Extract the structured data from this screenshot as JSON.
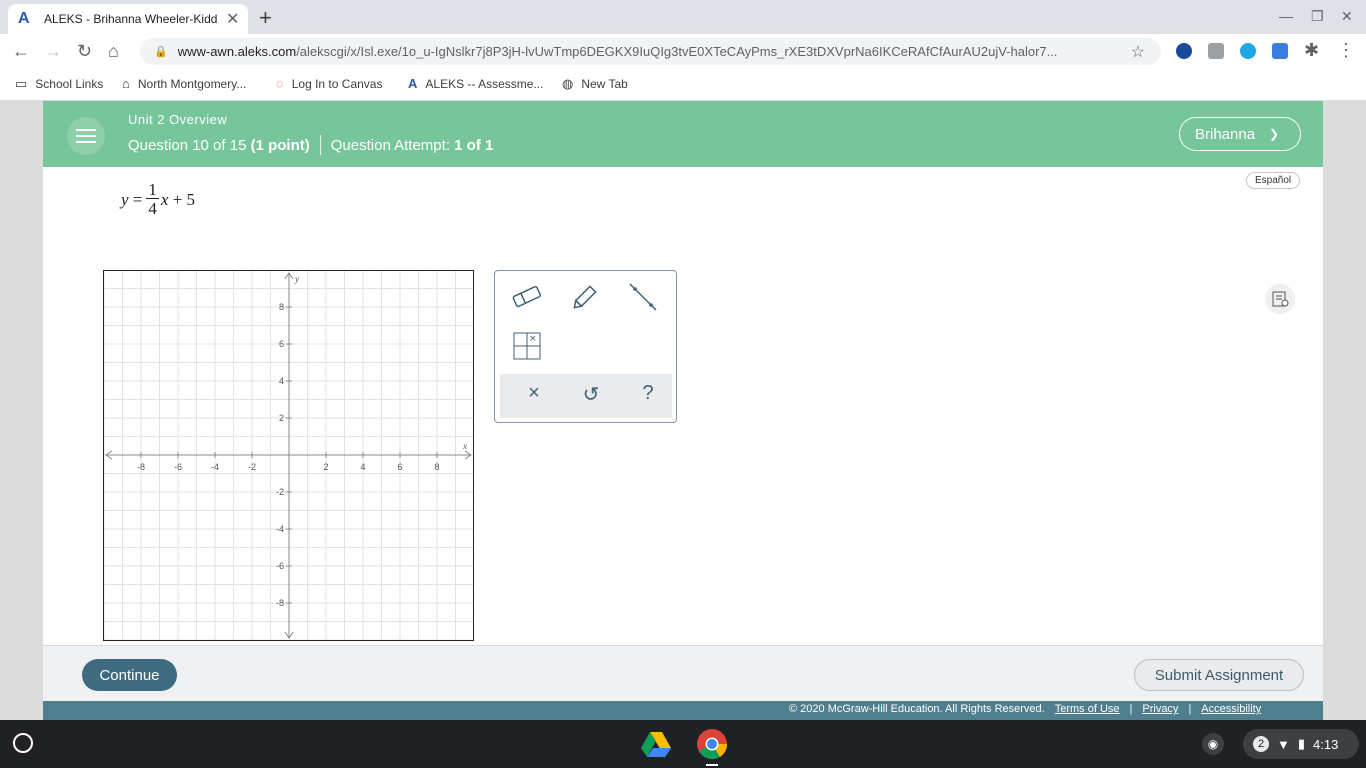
{
  "browser": {
    "tab_title": "ALEKS - Brihanna Wheeler-Kidd -",
    "url_host": "www-awn.aleks.com",
    "url_path": "/alekscgi/x/Isl.exe/1o_u-IgNslkr7j8P3jH-lvUwTmp6DEGKX9IuQIg3tvE0XTeCAyPms_rXE3tDXVprNa6IKCeRAfCfAurAU2ujV-halor7...",
    "bookmarks": [
      "School Links",
      "North Montgomery...",
      "Log In to Canvas",
      "ALEKS -- Assessme...",
      "New Tab"
    ]
  },
  "header": {
    "unit": "Unit 2 Overview",
    "question": "Question 10 of 15",
    "points": "(1 point)",
    "attempt_label": "Question Attempt:",
    "attempt_value": "1 of 1",
    "user": "Brihanna"
  },
  "language_button": "Español",
  "equation": {
    "lhs": "y",
    "eq": "=",
    "num": "1",
    "den": "4",
    "rest_var": "x",
    "rest": "+ 5"
  },
  "graph": {
    "x_label": "x",
    "y_label": "y",
    "x_ticks": [
      "-8",
      "-6",
      "-4",
      "-2",
      "2",
      "4",
      "6",
      "8"
    ],
    "y_ticks": [
      "8",
      "6",
      "4",
      "2",
      "-2",
      "-4",
      "-6",
      "-8"
    ]
  },
  "tools": {
    "eraser": "eraser-icon",
    "pencil": "pencil-icon",
    "line": "line-icon",
    "grid": "grid-icon",
    "clear": "×",
    "undo": "↺",
    "help": "?"
  },
  "footer": {
    "continue": "Continue",
    "submit": "Submit Assignment",
    "copyright": "© 2020 McGraw-Hill Education. All Rights Reserved.",
    "terms": "Terms of Use",
    "privacy": "Privacy",
    "accessibility": "Accessibility"
  },
  "shelf": {
    "notifications": "2",
    "time": "4:13"
  },
  "colors": {
    "header_green": "#77c59a",
    "accent_teal": "#3e6b7f",
    "legal_bar": "#4f7f8e"
  }
}
